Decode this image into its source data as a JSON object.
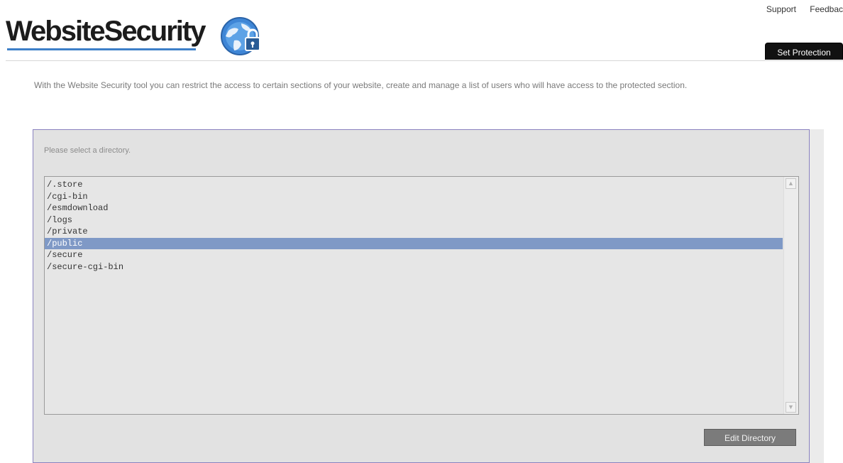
{
  "header": {
    "logo_text": "WebsiteSecurity",
    "links": [
      "Support",
      "Feedbac"
    ],
    "active_tab": "Set Protection",
    "brand_color": "#3d7fc8"
  },
  "intro_text": "With the Website Security tool you can restrict the access to certain sections of your website, create and manage a list of users who will have access to the protected section.",
  "panel": {
    "prompt": "Please select a directory.",
    "directories": [
      "/.store",
      "/cgi-bin",
      "/esmdownload",
      "/logs",
      "/private",
      "/public",
      "/secure",
      "/secure-cgi-bin"
    ],
    "selected_directory": "/public",
    "edit_button": "Edit Directory"
  }
}
